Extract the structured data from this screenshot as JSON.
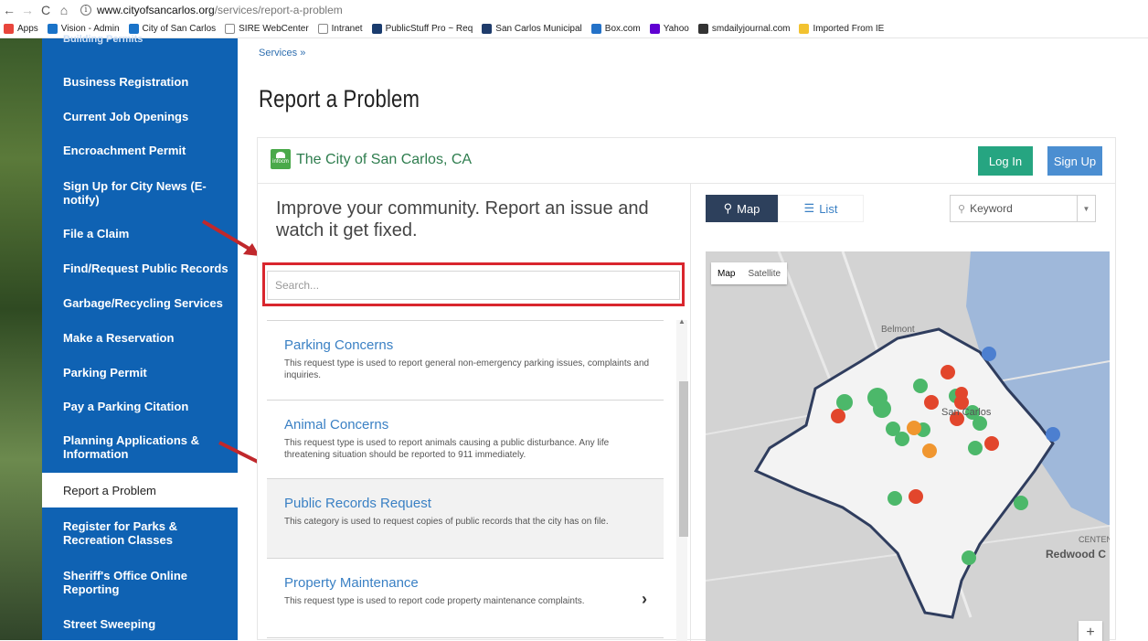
{
  "browser": {
    "url_host": "www.cityofsancarlos.org",
    "url_path": "/services/report-a-problem",
    "bookmarks": [
      {
        "label": "Apps",
        "color": "#e8453c"
      },
      {
        "label": "Vision - Admin",
        "color": "#1a73c8"
      },
      {
        "label": "City of San Carlos",
        "color": "#1a73c8"
      },
      {
        "label": "SIRE WebCenter",
        "color": "#ffffff"
      },
      {
        "label": "Intranet",
        "color": "#ffffff"
      },
      {
        "label": "PublicStuff Pro ~ Req",
        "color": "#1a3c6e"
      },
      {
        "label": "San Carlos Municipal",
        "color": "#1f3c6b"
      },
      {
        "label": "Box.com",
        "color": "#2472c8"
      },
      {
        "label": "Yahoo",
        "color": "#6001d2"
      },
      {
        "label": "smdailyjournal.com",
        "color": "#333333"
      },
      {
        "label": "Imported From IE",
        "color": "#f2c230"
      }
    ]
  },
  "sidebar": {
    "items": [
      {
        "label": "Building Permits"
      },
      {
        "label": "Business Registration"
      },
      {
        "label": "Current Job Openings"
      },
      {
        "label": "Encroachment Permit"
      },
      {
        "label": "Sign Up for City News (E-notify)"
      },
      {
        "label": "File a Claim"
      },
      {
        "label": "Find/Request Public Records"
      },
      {
        "label": "Garbage/Recycling Services"
      },
      {
        "label": "Make a Reservation"
      },
      {
        "label": "Parking Permit"
      },
      {
        "label": "Pay a Parking Citation"
      },
      {
        "label": "Planning Applications & Information"
      },
      {
        "label": "Report a Problem"
      },
      {
        "label": "Register for Parks & Recreation Classes"
      },
      {
        "label": "Sheriff's Office Online Reporting"
      },
      {
        "label": "Street Sweeping"
      }
    ]
  },
  "main": {
    "breadcrumb": "Services »",
    "page_title": "Report a Problem"
  },
  "widget": {
    "logo_text": "infocm",
    "city_name": "The City of San Carlos, CA",
    "login_label": "Log In",
    "signup_label": "Sign Up",
    "tagline": "Improve your community. Report an issue and watch it get fixed.",
    "search_placeholder": "Search...",
    "categories": [
      {
        "title": "Parking Concerns",
        "desc": "This request type is used to report general non-emergency parking issues, complaints and inquiries."
      },
      {
        "title": "Animal Concerns",
        "desc": "This request type is used to report animals causing a public disturbance. Any life threatening situation should be reported to 911 immediately."
      },
      {
        "title": "Public Records Request",
        "desc": "This category is used to request copies of public records that the city has on file."
      },
      {
        "title": "Property Maintenance",
        "desc": "This request type is used to report code property maintenance complaints."
      }
    ],
    "map_tab_label": "Map",
    "list_tab_label": "List",
    "keyword_placeholder": "Keyword",
    "map_type_map": "Map",
    "map_type_satellite": "Satellite",
    "map_labels": {
      "belmont": "Belmont",
      "redwood": "Redwood C",
      "centeni": "CENTENI",
      "san_carlos": "San Carlos"
    },
    "zoom_in": "+"
  },
  "colors": {
    "sidebar_blue": "#0f62b3",
    "login_green": "#26a581",
    "signup_blue": "#4b8ed1",
    "map_button_navy": "#2d405c",
    "highlight_red": "#d9262e",
    "pin_green": "#4cb86a",
    "pin_red": "#e2462c",
    "pin_blue": "#4c7fd0",
    "pin_orange": "#f0962f"
  }
}
